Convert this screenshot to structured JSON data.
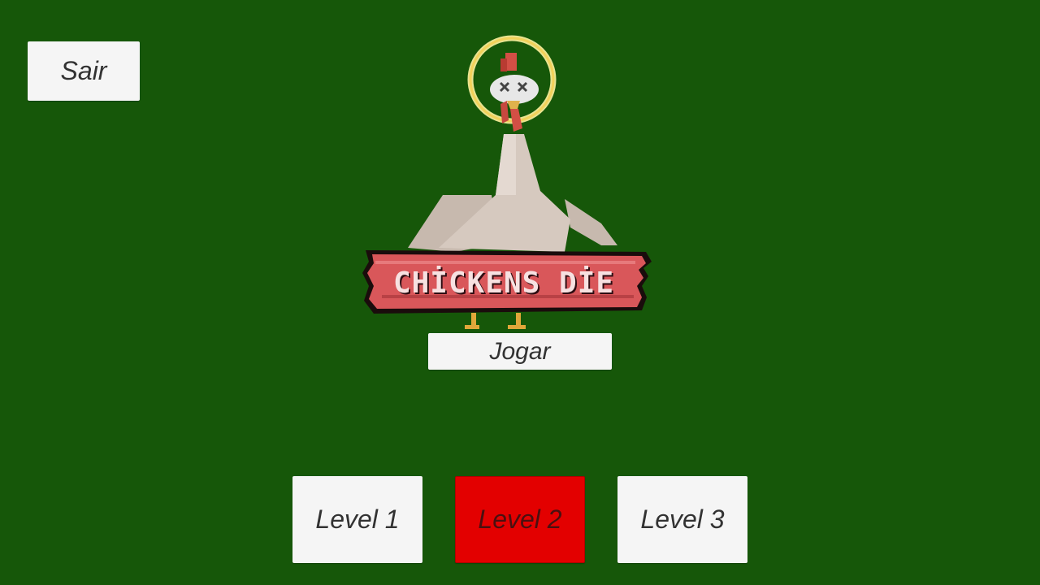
{
  "menu": {
    "exit_label": "Sair",
    "play_label": "Jogar"
  },
  "logo": {
    "title": "CHİCKENS DİE"
  },
  "levels": [
    {
      "label": "Level 1",
      "selected": false
    },
    {
      "label": "Level 2",
      "selected": true
    },
    {
      "label": "Level 3",
      "selected": false
    }
  ],
  "colors": {
    "background": "#165709",
    "button": "#f5f5f5",
    "button_text": "#323232",
    "selected_level": "#e30000",
    "sign_wood": "#d9575a"
  },
  "icons": {
    "logo": "dead-chicken-logo",
    "halo": "halo-icon"
  }
}
